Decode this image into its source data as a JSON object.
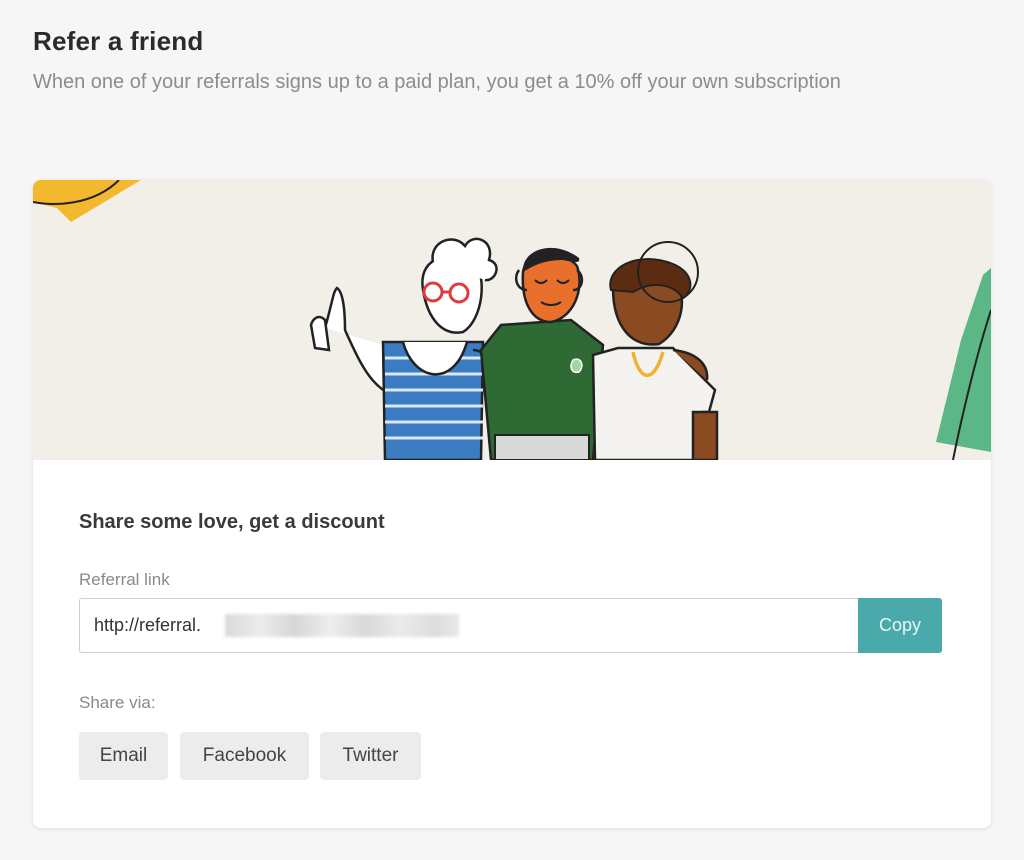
{
  "page": {
    "title": "Refer a friend",
    "subtitle": "When one of your referrals signs up to a paid plan, you get a 10% off your own subscription"
  },
  "card": {
    "heading": "Share some love, get a discount",
    "referral_label": "Referral link",
    "referral_value": "http://referral.",
    "copy_label": "Copy",
    "share_label": "Share via:",
    "share_buttons": [
      "Email",
      "Facebook",
      "Twitter"
    ]
  },
  "colors": {
    "accent": "#4aa9aa",
    "hero_bg": "#f2efe9",
    "page_bg": "#f6f6f6"
  }
}
